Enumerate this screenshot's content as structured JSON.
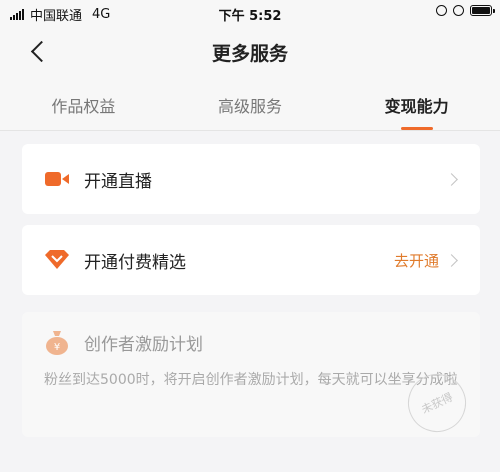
{
  "status_bar": {
    "carrier": "中国联通",
    "network": "4G",
    "time": "下午 5:52",
    "icons": [
      "signal-icon",
      "orientation-lock-icon",
      "alarm-icon",
      "battery-icon"
    ]
  },
  "nav": {
    "back_icon": "chevron-left-icon",
    "title": "更多服务"
  },
  "tabs": [
    {
      "label": "作品权益",
      "active": false
    },
    {
      "label": "高级服务",
      "active": false
    },
    {
      "label": "变现能力",
      "active": true
    }
  ],
  "services": {
    "live": {
      "label": "开通直播",
      "icon": "video-camera-icon"
    },
    "paid": {
      "label": "开通付费精选",
      "icon": "diamond-icon",
      "action": "去开通"
    }
  },
  "incentive": {
    "icon": "money-bag-icon",
    "title": "创作者激励计划",
    "description": "粉丝到达5000时，将开启创作者激励计划，每天就可以坐享分成啦",
    "stamp": "未获得"
  },
  "colors": {
    "accent": "#ef6a2a",
    "action_text": "#e07b2c",
    "background": "#f4f4f6"
  }
}
